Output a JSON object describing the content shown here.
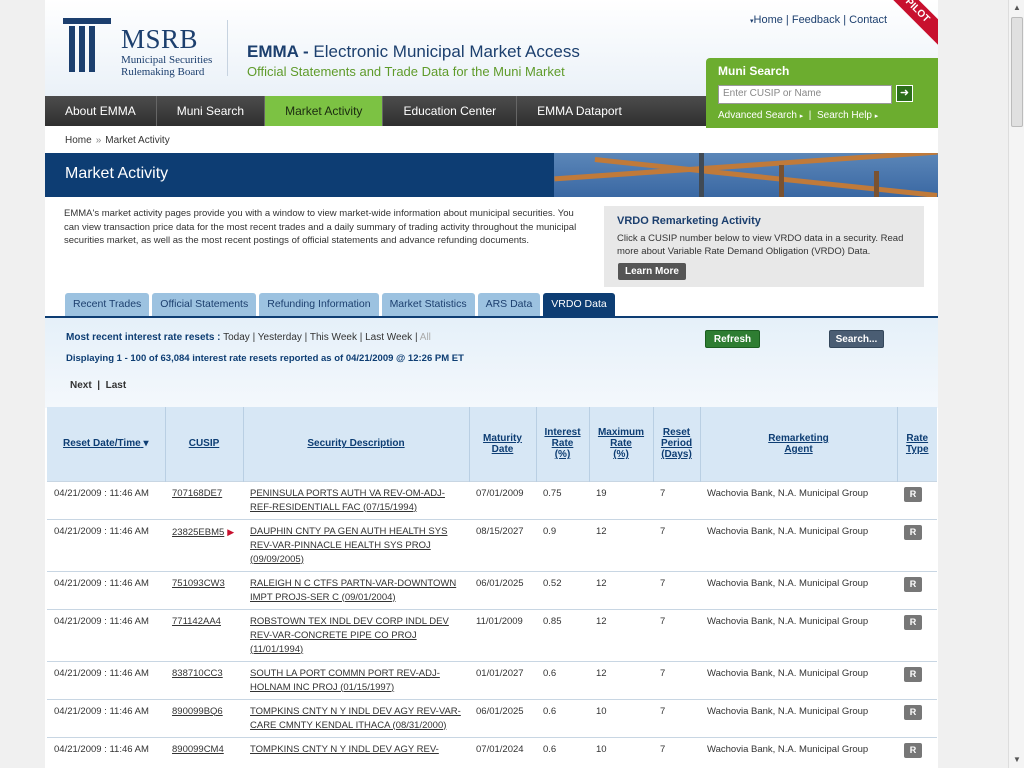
{
  "header": {
    "logo_big": "MSRB",
    "logo_small_1": "Municipal Securities",
    "logo_small_2": "Rulemaking Board",
    "title_bold": "EMMA - ",
    "title_rest": "Electronic Municipal Market Access",
    "subtitle": "Official Statements and Trade Data for the Muni Market",
    "toplinks": [
      "Home",
      "Feedback",
      "Contact"
    ],
    "pilot": "PILOT"
  },
  "muni_search": {
    "title": "Muni Search",
    "placeholder": "Enter CUSIP or Name",
    "go_icon": "arrow-right-icon",
    "advanced": "Advanced Search",
    "help": "Search Help"
  },
  "nav": [
    "About EMMA",
    "Muni Search",
    "Market Activity",
    "Education Center",
    "EMMA Dataport"
  ],
  "breadcrumb": {
    "home": "Home",
    "current": "Market Activity"
  },
  "banner": {
    "title": "Market Activity"
  },
  "intro": "EMMA's market activity pages provide you with a window to view market-wide information about municipal securities. You can view transaction price data for the most recent trades and a daily summary of trading activity throughout the municipal securities market, as well as the most recent postings of official statements and advance refunding documents.",
  "vrdo_box": {
    "title": "VRDO Remarketing Activity",
    "text": "Click a CUSIP number below to view VRDO data in a security. Read more about Variable Rate Demand Obligation (VRDO) Data.",
    "button": "Learn More"
  },
  "tabs": [
    "Recent Trades",
    "Official Statements",
    "Refunding Information",
    "Market Statistics",
    "ARS Data",
    "VRDO Data"
  ],
  "resets": {
    "label": "Most recent interest rate resets :",
    "filters": [
      "Today",
      "Yesterday",
      "This Week",
      "Last Week",
      "All"
    ]
  },
  "displaying": "Displaying 1 - 100 of 63,084 interest rate resets reported as of 04/21/2009 @ 12:26 PM ET",
  "pager": {
    "next": "Next",
    "last": "Last"
  },
  "buttons": {
    "refresh": "Refresh",
    "search": "Search..."
  },
  "table": {
    "headers": {
      "reset": "Reset Date/Time",
      "cusip": "CUSIP",
      "desc": "Security Description",
      "maturity_1": "Maturity",
      "maturity_2": "Date",
      "rate_1": "Interest",
      "rate_2": "Rate",
      "rate_3": "(%)",
      "max_1": "Maximum",
      "max_2": "Rate",
      "max_3": "(%)",
      "period_1": "Reset",
      "period_2": "Period",
      "period_3": "(Days)",
      "agent_1": "Remarketing",
      "agent_2": "Agent",
      "type_1": "Rate",
      "type_2": "Type"
    },
    "rows": [
      {
        "reset": "04/21/2009 : 11:46 AM",
        "cusip": "707168DE7",
        "desc": "PENINSULA PORTS AUTH VA REV-OM-ADJ-REF-RESIDENTIALL FAC (07/15/1994)",
        "maturity": "07/01/2009",
        "rate": "0.75",
        "max": "19",
        "period": "7",
        "agent": "Wachovia Bank, N.A. Municipal Group",
        "type": "R"
      },
      {
        "reset": "04/21/2009 : 11:46 AM",
        "cusip": "23825EBM5",
        "desc": "DAUPHIN CNTY PA GEN AUTH HEALTH SYS REV-VAR-PINNACLE HEALTH SYS PROJ (09/09/2005)",
        "maturity": "08/15/2027",
        "rate": "0.9",
        "max": "12",
        "period": "7",
        "agent": "Wachovia Bank, N.A. Municipal Group",
        "type": "R"
      },
      {
        "reset": "04/21/2009 : 11:46 AM",
        "cusip": "751093CW3",
        "desc": "RALEIGH N C CTFS PARTN-VAR-DOWNTOWN IMPT PROJS-SER C (09/01/2004)",
        "maturity": "06/01/2025",
        "rate": "0.52",
        "max": "12",
        "period": "7",
        "agent": "Wachovia Bank, N.A. Municipal Group",
        "type": "R"
      },
      {
        "reset": "04/21/2009 : 11:46 AM",
        "cusip": "771142AA4",
        "desc": "ROBSTOWN TEX INDL DEV CORP INDL DEV REV-VAR-CONCRETE PIPE CO PROJ (11/01/1994)",
        "maturity": "11/01/2009",
        "rate": "0.85",
        "max": "12",
        "period": "7",
        "agent": "Wachovia Bank, N.A. Municipal Group",
        "type": "R"
      },
      {
        "reset": "04/21/2009 : 11:46 AM",
        "cusip": "838710CC3",
        "desc": "SOUTH LA PORT COMMN PORT REV-ADJ-HOLNAM INC PROJ (01/15/1997)",
        "maturity": "01/01/2027",
        "rate": "0.6",
        "max": "12",
        "period": "7",
        "agent": "Wachovia Bank, N.A. Municipal Group",
        "type": "R"
      },
      {
        "reset": "04/21/2009 : 11:46 AM",
        "cusip": "890099BQ6",
        "desc": "TOMPKINS CNTY N Y INDL DEV AGY REV-VAR-CARE CMNTY KENDAL ITHACA (08/31/2000)",
        "maturity": "06/01/2025",
        "rate": "0.6",
        "max": "10",
        "period": "7",
        "agent": "Wachovia Bank, N.A. Municipal Group",
        "type": "R"
      },
      {
        "reset": "04/21/2009 : 11:46 AM",
        "cusip": "890099CM4",
        "desc": "TOMPKINS CNTY N Y INDL DEV AGY REV-",
        "maturity": "07/01/2024",
        "rate": "0.6",
        "max": "10",
        "period": "7",
        "agent": "Wachovia Bank, N.A. Municipal Group",
        "type": "R"
      }
    ]
  },
  "colors": {
    "navy": "#0d3d73",
    "green": "#6cad2f",
    "active_tab": "#0d3d73"
  }
}
